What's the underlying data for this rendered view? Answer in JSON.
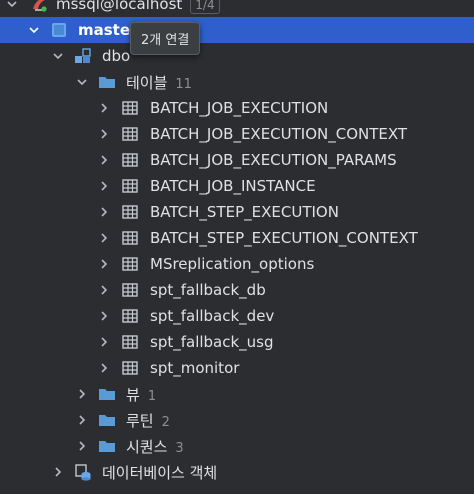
{
  "tree": {
    "connection": {
      "label": "mssql@localhost",
      "badge": "1/4"
    },
    "database": {
      "label": "master"
    },
    "schema": {
      "label": "dbo"
    },
    "tables_group": {
      "label": "테이블",
      "count": "11"
    },
    "tables": [
      "BATCH_JOB_EXECUTION",
      "BATCH_JOB_EXECUTION_CONTEXT",
      "BATCH_JOB_EXECUTION_PARAMS",
      "BATCH_JOB_INSTANCE",
      "BATCH_STEP_EXECUTION",
      "BATCH_STEP_EXECUTION_CONTEXT",
      "MSreplication_options",
      "spt_fallback_db",
      "spt_fallback_dev",
      "spt_fallback_usg",
      "spt_monitor"
    ],
    "views_group": {
      "label": "뷰",
      "count": "1"
    },
    "routines_group": {
      "label": "루틴",
      "count": "2"
    },
    "sequences_group": {
      "label": "시퀀스",
      "count": "3"
    },
    "db_objects": {
      "label": "데이터베이스 객체"
    }
  },
  "tooltip": {
    "text": "2개 연결"
  },
  "colors": {
    "background": "#2b2d30",
    "selection": "#2e5fcc",
    "folder": "#5b9bd5",
    "table_icon": "#c5c9ce",
    "muted": "#8c8f94"
  }
}
